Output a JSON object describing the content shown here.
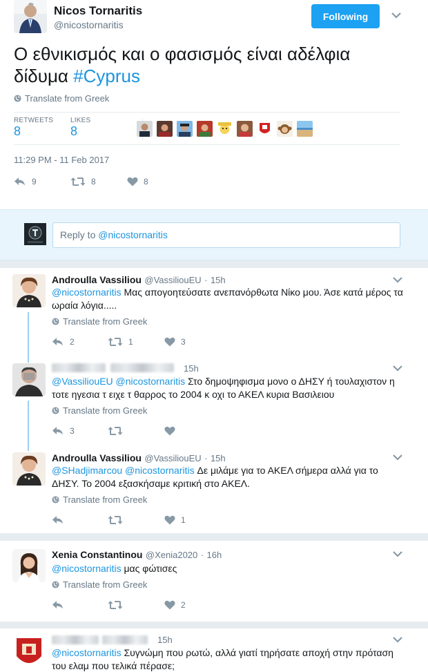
{
  "tweet": {
    "author_name": "Nicos Tornaritis",
    "author_handle": "@nicostornaritis",
    "follow_label": "Following",
    "text_plain": "Ο εθνικισμός και ο φασισμός είναι αδέλφια δίδυμα ",
    "hashtag": "#Cyprus",
    "translate_label": "Translate from Greek",
    "retweets_label": "RETWEETS",
    "retweets_count": "8",
    "likes_label": "LIKES",
    "likes_count": "8",
    "timestamp": "11:29 PM - 11 Feb 2017",
    "actions": {
      "reply_count": "9",
      "retweet_count": "8",
      "like_count": "8"
    }
  },
  "reply_box": {
    "prefix": "Reply to ",
    "mention": "@nicostornaritis"
  },
  "replies": [
    {
      "name": "Androulla Vassiliou",
      "handle": "@VassiliouEU",
      "dot": "·",
      "time": "15h",
      "mention": "@nicostornaritis",
      "text": " Μας απογοητεύσατε ανεπανόρθωτα Νίκο μου. Άσε κατά μέρος τα ωραία λόγια.....",
      "translate": "Translate from Greek",
      "reply_count": "2",
      "retweet_count": "1",
      "like_count": "3"
    },
    {
      "name": "",
      "handle": "",
      "time": "15h",
      "mention": "@VassiliouEU @nicostornaritis",
      "text": " Στο δημοψηφισμα μονο ο ΔΗΣΥ ή τουλαχιστον η τοτε ηγεσια τ ειχε τ θαρρος το 2004 κ οχι το ΑΚΕΛ κυρια Βασιλειου",
      "translate": "Translate from Greek",
      "reply_count": "3",
      "retweet_count": "",
      "like_count": ""
    },
    {
      "name": "Androulla Vassiliou",
      "handle": "@VassiliouEU",
      "dot": "·",
      "time": "15h",
      "mention": "@SHadjimarcou @nicostornaritis",
      "text": " Δε μιλάμε για το ΑΚΕΛ σήμερα αλλά για το ΔΗΣΥ. Το 2004 εξασκήσαμε κριτική στο ΑΚΕΛ.",
      "translate": "Translate from Greek",
      "reply_count": "",
      "retweet_count": "",
      "like_count": "1"
    },
    {
      "name": "Xenia Constantinou",
      "handle": "@Xenia2020",
      "dot": "·",
      "time": "16h",
      "mention": "@nicostornaritis",
      "text": " μας φώτισες",
      "translate": "Translate from Greek",
      "reply_count": "",
      "retweet_count": "",
      "like_count": "2"
    },
    {
      "name": "",
      "handle": "",
      "time": "15h",
      "mention": "@nicostornaritis",
      "text": " Συγνώμη που ρωτώ, αλλά γιατί τηρήσατε αποχή στην πρόταση του ελαμ που τελικά πέρασε;"
    }
  ],
  "colors": {
    "accent": "#1da1f2",
    "link": "#1b95e0",
    "muted": "#657786",
    "thread": "#9ad0f3"
  },
  "icons": [
    "chevron-down-icon",
    "globe-icon",
    "reply-icon",
    "retweet-icon",
    "heart-icon"
  ]
}
